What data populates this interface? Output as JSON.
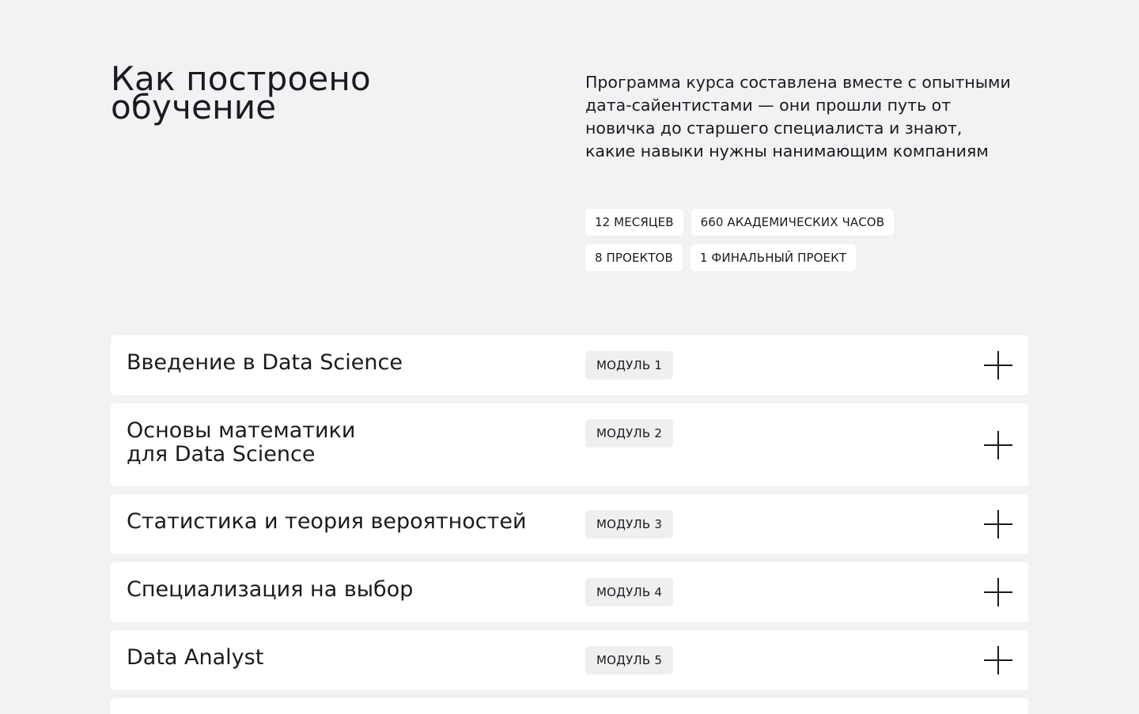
{
  "heading": {
    "title": "Как построено\nобучение",
    "description": "Программа курса составлена вместе с опытными дата-сайентистами — они прошли путь от новичка до старшего специалиста и знают, какие навыки нужны нанимающим компаниям"
  },
  "tags": [
    [
      "12 МЕСЯЦЕВ",
      "660 АКАДЕМИЧЕСКИХ ЧАСОВ"
    ],
    [
      "8 ПРОЕКТОВ",
      "1 ФИНАЛЬНЫЙ ПРОЕКТ"
    ]
  ],
  "modules": [
    {
      "title": "Введение в Data Science",
      "badge": "МОДУЛЬ 1",
      "icon": "plus-icon"
    },
    {
      "title": "Основы математики\nдля Data Science",
      "badge": "МОДУЛЬ 2",
      "icon": "plus-icon"
    },
    {
      "title": "Статистика и теория вероятностей",
      "badge": "МОДУЛЬ 3",
      "icon": "plus-icon"
    },
    {
      "title": "Специализация на выбор",
      "badge": "МОДУЛЬ 4",
      "icon": "plus-icon"
    },
    {
      "title": "Data Analyst",
      "badge": "МОДУЛЬ 5",
      "icon": "plus-icon"
    }
  ]
}
